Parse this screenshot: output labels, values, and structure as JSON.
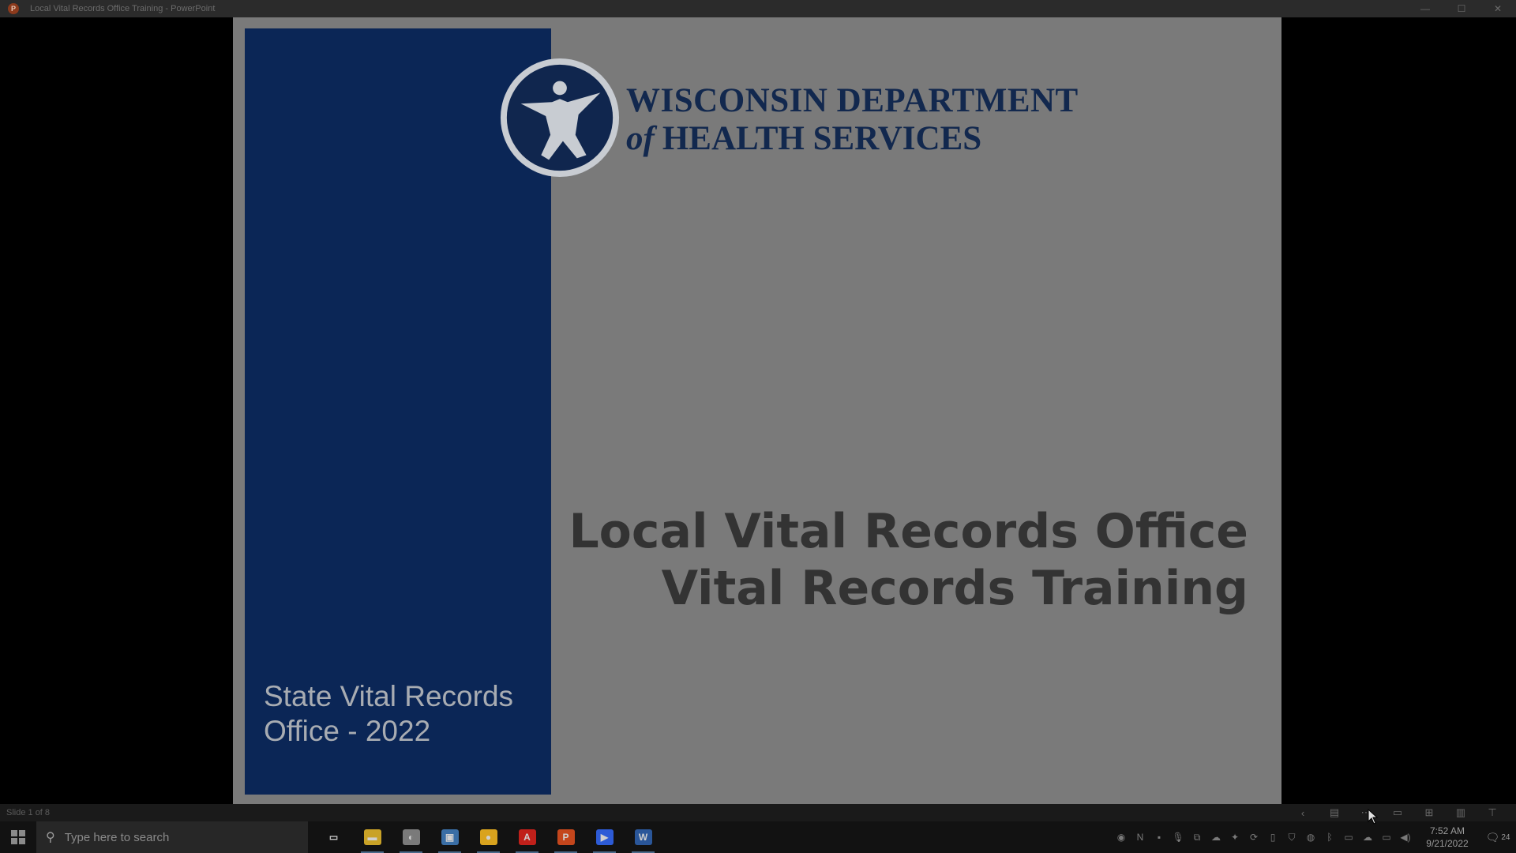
{
  "window": {
    "title": "Local Vital Records Office Training - PowerPoint",
    "app_icon": "powerpoint-icon",
    "controls": [
      "minimize",
      "maximize",
      "close"
    ]
  },
  "slide": {
    "panel_text": "State Vital Records Office - 2022",
    "logo": {
      "line1": "WISCONSIN DEPARTMENT",
      "line2_prefix": "of",
      "line2": "HEALTH SERVICES"
    },
    "title_line1": "Local Vital Records Office",
    "title_line2": "Vital Records Training",
    "colors": {
      "panel": "#0b2656",
      "logo_text": "#12284e",
      "title": "#333333"
    }
  },
  "statusbar": {
    "slide_indicator": "Slide 1 of 8",
    "icons": [
      "prev-slide-icon",
      "notes-icon",
      "menu-icon",
      "normal-view-icon",
      "slide-sorter-icon",
      "reading-view-icon",
      "slideshow-icon"
    ]
  },
  "taskbar": {
    "search_placeholder": "Type here to search",
    "apps": [
      {
        "name": "task-view",
        "glyph": "▭"
      },
      {
        "name": "file-explorer",
        "glyph": "▬",
        "color": "#c9a227"
      },
      {
        "name": "app-3",
        "glyph": "◐",
        "color": "#7a7a7a"
      },
      {
        "name": "app-4",
        "glyph": "▣",
        "color": "#3a6ea5"
      },
      {
        "name": "chrome",
        "glyph": "●",
        "color": "#d9a31e"
      },
      {
        "name": "acrobat",
        "glyph": "A",
        "color": "#c0201a"
      },
      {
        "name": "powerpoint",
        "glyph": "P",
        "color": "#c4461c"
      },
      {
        "name": "zoom",
        "glyph": "▶",
        "color": "#2d5bd6"
      },
      {
        "name": "word",
        "glyph": "W",
        "color": "#2a5699"
      }
    ],
    "clock_time": "7:52 AM",
    "clock_date": "9/21/2022",
    "notification_count": "24"
  }
}
